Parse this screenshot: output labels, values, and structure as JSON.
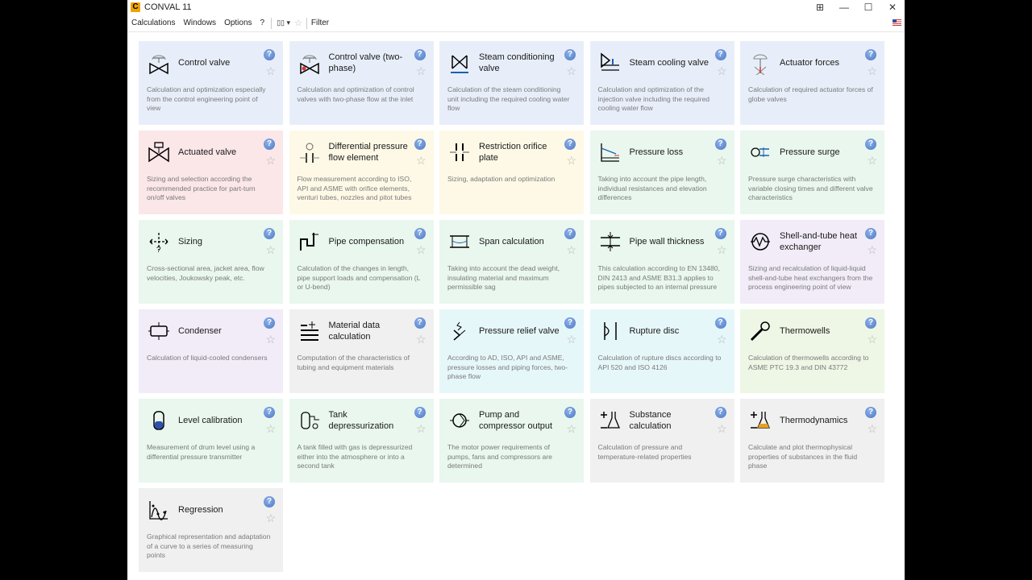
{
  "window": {
    "title": "CONVAL 11",
    "app_icon_letter": "C"
  },
  "window_controls": {
    "layout": "⊞",
    "minimize": "—",
    "maximize": "☐",
    "close": "✕"
  },
  "menu": {
    "items": [
      "Calculations",
      "Windows",
      "Options",
      "?"
    ],
    "view_toggle": "▯▯ ▾",
    "star_filter": "☆",
    "filter_label": "Filter"
  },
  "card_glyphs": {
    "help": "?",
    "favorite": "☆"
  },
  "colors": {
    "blue": "#e8eef9",
    "pink": "#fbe6e8",
    "yellow": "#fdf9e6",
    "green": "#e9f7ee",
    "purple": "#f1ecf8",
    "cyan": "#e6f7f9",
    "gray": "#f0f0f0",
    "lightgreen": "#eef7e6"
  },
  "cards": [
    {
      "title": "Control valve",
      "desc": "Calculation and optimization especially from the control engineering point of view",
      "color": "blue",
      "icon": "control-valve"
    },
    {
      "title": "Control valve (two-phase)",
      "desc": "Calculation and optimization of control valves with two-phase flow at the inlet",
      "color": "blue",
      "icon": "control-valve-two-phase"
    },
    {
      "title": "Steam conditioning valve",
      "desc": "Calculation of the steam conditioning unit including the required cooling water flow",
      "color": "blue",
      "icon": "steam-conditioning"
    },
    {
      "title": "Steam cooling valve",
      "desc": "Calculation and optimization of the injection valve including the required cooling water flow",
      "color": "blue",
      "icon": "steam-cooling"
    },
    {
      "title": "Actuator forces",
      "desc": "Calculation of required actuator forces of globe valves",
      "color": "blue",
      "icon": "actuator-forces"
    },
    {
      "title": "Actuated valve",
      "desc": "Sizing and selection according the recommended practice for part-turn on/off valves",
      "color": "pink",
      "icon": "actuated-valve"
    },
    {
      "title": "Differential pressure flow element",
      "desc": "Flow measurement according to ISO, API and ASME with orifice elements, venturi tubes, nozzles and pitot tubes",
      "color": "yellow",
      "icon": "flow-element"
    },
    {
      "title": "Restriction orifice plate",
      "desc": "Sizing, adaptation and optimization",
      "color": "yellow",
      "icon": "orifice-plate"
    },
    {
      "title": "Pressure loss",
      "desc": "Taking into account the pipe length, individual resistances and elevation differences",
      "color": "green",
      "icon": "pressure-loss"
    },
    {
      "title": "Pressure surge",
      "desc": "Pressure surge characteristics with variable closing times and different valve characteristics",
      "color": "green",
      "icon": "pressure-surge"
    },
    {
      "title": "Sizing",
      "desc": "Cross-sectional area, jacket area, flow velocities, Joukowsky peak, etc.",
      "color": "green",
      "icon": "sizing"
    },
    {
      "title": "Pipe compensation",
      "desc": "Calculation of the changes in length, pipe support loads and compensation (L or U-bend)",
      "color": "green",
      "icon": "pipe-compensation"
    },
    {
      "title": "Span calculation",
      "desc": "Taking into account the dead weight, insulating material and maximum permissible sag",
      "color": "green",
      "icon": "span"
    },
    {
      "title": "Pipe wall thickness",
      "desc": "This calculation according to EN 13480, DIN 2413 and ASME B31.3 applies to pipes subjected to an internal pressure",
      "color": "green",
      "icon": "wall-thickness"
    },
    {
      "title": "Shell-and-tube heat exchanger",
      "desc": "Sizing and recalculation of liquid-liquid shell-and-tube heat exchangers from the process engineering point of view",
      "color": "purple",
      "icon": "heat-exchanger"
    },
    {
      "title": "Condenser",
      "desc": "Calculation of liquid-cooled condensers",
      "color": "purple",
      "icon": "condenser"
    },
    {
      "title": "Material data calculation",
      "desc": "Computation of the characteristics of tubing and equipment materials",
      "color": "gray",
      "icon": "material-data"
    },
    {
      "title": "Pressure relief valve",
      "desc": "According to AD, ISO, API and ASME, pressure losses and piping forces, two-phase flow",
      "color": "cyan",
      "icon": "relief-valve"
    },
    {
      "title": "Rupture disc",
      "desc": "Calculation of rupture discs according to API 520 and ISO 4126",
      "color": "cyan",
      "icon": "rupture-disc"
    },
    {
      "title": "Thermowells",
      "desc": "Calculation of thermowells according to ASME PTC 19.3 and DIN 43772",
      "color": "lightgreen",
      "icon": "thermowell"
    },
    {
      "title": "Level calibration",
      "desc": "Measurement of drum level using a differential pressure transmitter",
      "color": "green",
      "icon": "level-calibration"
    },
    {
      "title": "Tank depressurization",
      "desc": "A tank filled with gas is depressurized either into the atmosphere or into a second tank",
      "color": "green",
      "icon": "tank"
    },
    {
      "title": "Pump and compressor output",
      "desc": "The motor power requirements of pumps, fans and compressors are determined",
      "color": "green",
      "icon": "pump"
    },
    {
      "title": "Substance calculation",
      "desc": "Calculation of pressure and temperature-related properties",
      "color": "gray",
      "icon": "substance"
    },
    {
      "title": "Thermodynamics",
      "desc": "Calculate and plot thermophysical properties of substances in the fluid phase",
      "color": "gray",
      "icon": "thermodynamics"
    },
    {
      "title": "Regression",
      "desc": "Graphical representation and adaptation of a curve to a series of measuring points",
      "color": "gray",
      "icon": "regression"
    }
  ]
}
